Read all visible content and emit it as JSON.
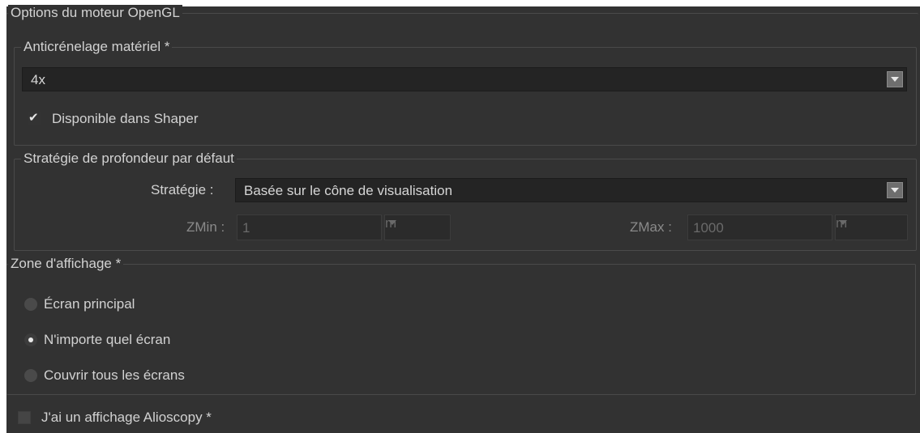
{
  "opengl_group": {
    "title": "Options du moteur OpenGL"
  },
  "antialiasing": {
    "title": "Anticrénelage matériel *",
    "selected": "4x",
    "shaper_checkbox": {
      "label": "Disponible dans Shaper",
      "checked": true
    }
  },
  "depth_strategy": {
    "title": "Stratégie de profondeur par défaut",
    "strategy_label": "Stratégie :",
    "strategy_value": "Basée sur le cône de visualisation",
    "zmin_label": "ZMin :",
    "zmin_value": "1",
    "zmin_unit": "m",
    "zmax_label": "ZMax :",
    "zmax_value": "1000",
    "zmax_unit": "m"
  },
  "display_zone": {
    "title": "Zone d'affichage *",
    "options": [
      {
        "label": "Écran principal",
        "selected": false
      },
      {
        "label": "N'importe quel écran",
        "selected": true
      },
      {
        "label": "Couvrir tous les écrans",
        "selected": false
      }
    ]
  },
  "alioscopy": {
    "label": "J'ai un affichage Alioscopy *",
    "checked": false
  },
  "colors": {
    "panel_bg": "#323232",
    "text": "#d2d2d2",
    "dim_text": "#8a8a8a",
    "combo_bg": "#242424"
  },
  "icons": {
    "dropdown_arrow": "chevron-down-icon",
    "check": "checkmark-icon"
  }
}
